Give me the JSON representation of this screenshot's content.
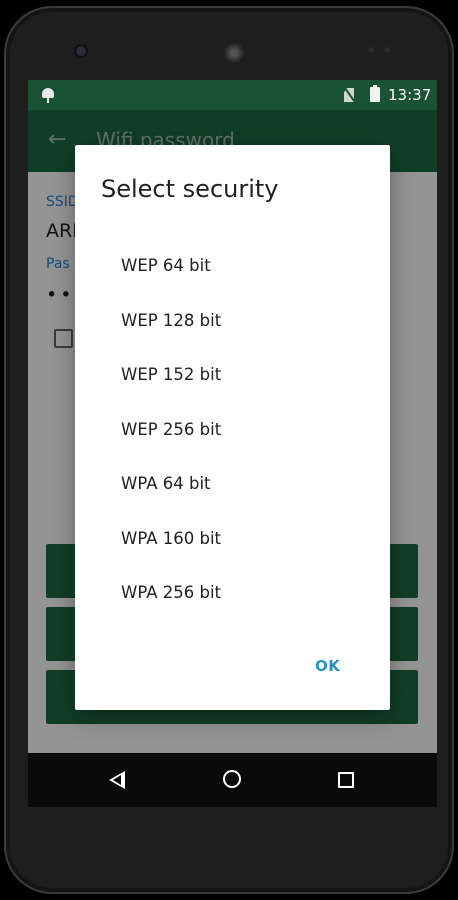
{
  "status_bar": {
    "time": "13:37"
  },
  "toolbar": {
    "title": "Wifi password"
  },
  "form": {
    "ssid_label": "SSID",
    "ssid_value": "ARI",
    "password_label": "Pas",
    "password_value": "••"
  },
  "dialog": {
    "title": "Select security",
    "options": [
      "WEP 64 bit",
      "WEP 128 bit",
      "WEP 152 bit",
      "WEP 256 bit",
      "WPA 64 bit",
      "WPA 160 bit",
      "WPA 256 bit"
    ],
    "ok_label": "OK"
  },
  "colors": {
    "status_bar": "#1a5236",
    "toolbar": "#1e6b43",
    "accent": "#2693c8",
    "label_blue": "#2b84d6"
  },
  "icons": {
    "status_left": "android-debug-icon",
    "status_right": [
      "no-sim-icon",
      "battery-charging-icon"
    ],
    "nav": [
      "back-triangle-icon",
      "home-circle-icon",
      "recents-square-icon"
    ]
  }
}
